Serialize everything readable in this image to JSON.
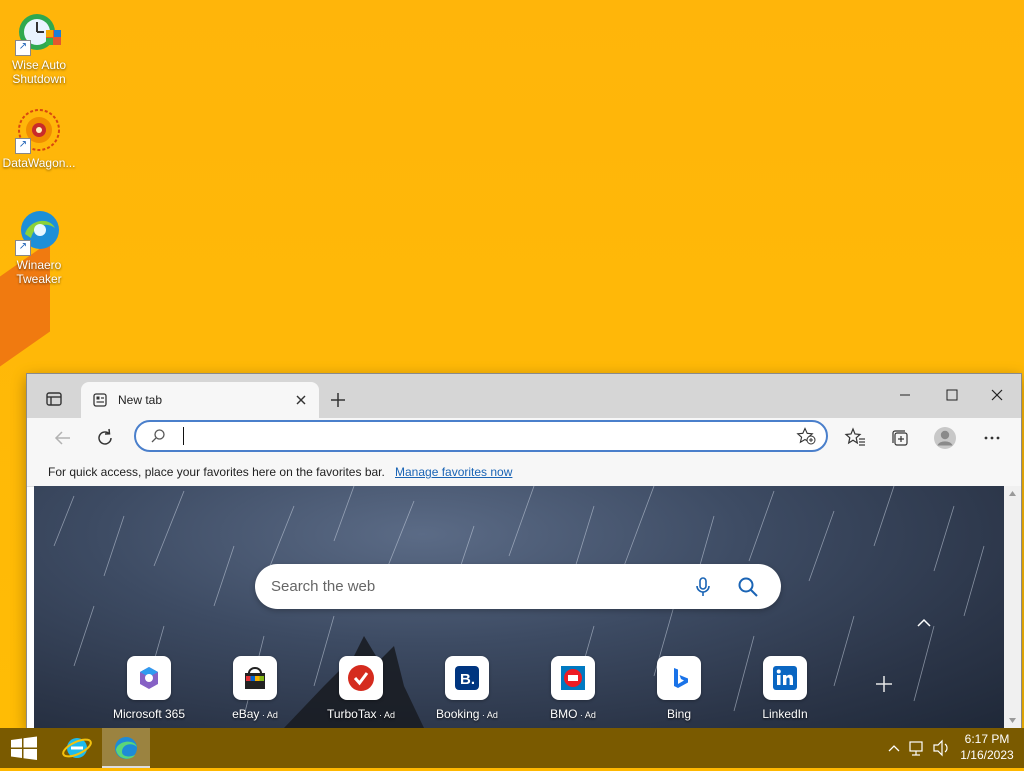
{
  "desktop": {
    "icons": [
      {
        "label": "Wise Auto Shutdown"
      },
      {
        "label": "DataWagon..."
      },
      {
        "label": "Winaero Tweaker"
      }
    ]
  },
  "browser": {
    "tab": {
      "title": "New tab"
    },
    "favorites_bar": {
      "message": "For quick access, place your favorites here on the favorites bar.",
      "link": "Manage favorites now"
    },
    "ntp": {
      "search_placeholder": "Search the web",
      "tiles": [
        {
          "label": "Microsoft 365",
          "ad": ""
        },
        {
          "label": "eBay",
          "ad": " · Ad"
        },
        {
          "label": "TurboTax",
          "ad": " · Ad"
        },
        {
          "label": "Booking",
          "ad": " · Ad"
        },
        {
          "label": "BMO",
          "ad": " · Ad"
        },
        {
          "label": "Bing",
          "ad": ""
        },
        {
          "label": "LinkedIn",
          "ad": ""
        }
      ]
    }
  },
  "taskbar": {
    "time": "6:17 PM",
    "date": "1/16/2023"
  },
  "colors": {
    "desktop": "#FFB800",
    "taskbar": "#7A5A00",
    "address_focus": "#4A7FCB",
    "link": "#1a64b5"
  }
}
